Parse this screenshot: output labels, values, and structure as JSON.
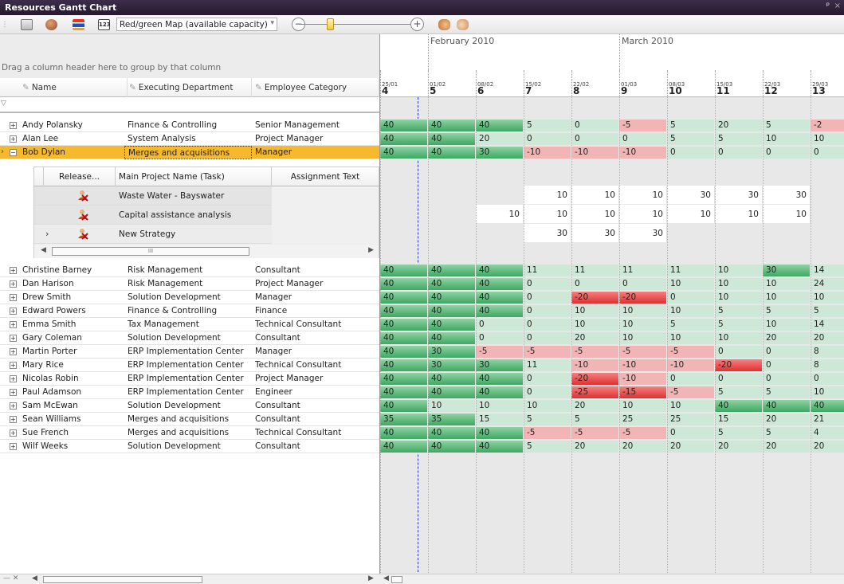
{
  "window": {
    "title": "Resources Gantt Chart"
  },
  "toolbar": {
    "map_select": "Red/green Map (available capacity)"
  },
  "group_panel": {
    "text": "Drag a column header here to group by that column"
  },
  "columns": {
    "name": "Name",
    "department": "Executing Department",
    "category": "Employee Category"
  },
  "detail_columns": {
    "release": "Release...",
    "project": "Main Project Name (Task)",
    "assignment": "Assignment Text"
  },
  "timeline": {
    "months": [
      "February 2010",
      "March 2010"
    ],
    "weeks": [
      {
        "date": "25/01",
        "num": "4"
      },
      {
        "date": "01/02",
        "num": "5"
      },
      {
        "date": "08/02",
        "num": "6"
      },
      {
        "date": "15/02",
        "num": "7"
      },
      {
        "date": "22/02",
        "num": "8"
      },
      {
        "date": "01/03",
        "num": "9"
      },
      {
        "date": "08/03",
        "num": "10"
      },
      {
        "date": "15/03",
        "num": "11"
      },
      {
        "date": "22/03",
        "num": "12"
      },
      {
        "date": "29/03",
        "num": "13"
      }
    ]
  },
  "resources": [
    {
      "name": "Andy Polansky",
      "department": "Finance & Controlling",
      "category": "Senior Management",
      "capacity": [
        "40",
        "40",
        "40",
        "5",
        "0",
        "-5",
        "5",
        "20",
        "5",
        "-2"
      ]
    },
    {
      "name": "Alan Lee",
      "department": "System Analysis",
      "category": "Project Manager",
      "capacity": [
        "40",
        "40",
        "20",
        "0",
        "0",
        "0",
        "5",
        "5",
        "10",
        "10"
      ]
    },
    {
      "name": "Bob Dylan",
      "department": "Merges and acquisitions",
      "category": "Manager",
      "capacity": [
        "40",
        "40",
        "30",
        "-10",
        "-10",
        "-10",
        "0",
        "0",
        "0",
        "0"
      ]
    },
    {
      "name": "Christine Barney",
      "department": "Risk Management",
      "category": "Consultant",
      "capacity": [
        "40",
        "40",
        "40",
        "11",
        "11",
        "11",
        "11",
        "10",
        "30",
        "14"
      ]
    },
    {
      "name": "Dan Harison",
      "department": "Risk Management",
      "category": "Project Manager",
      "capacity": [
        "40",
        "40",
        "40",
        "0",
        "0",
        "0",
        "10",
        "10",
        "10",
        "24"
      ]
    },
    {
      "name": "Drew Smith",
      "department": "Solution Development",
      "category": "Manager",
      "capacity": [
        "40",
        "40",
        "40",
        "0",
        "-20",
        "-20",
        "0",
        "10",
        "10",
        "10"
      ]
    },
    {
      "name": "Edward Powers",
      "department": "Finance & Controlling",
      "category": "Finance",
      "capacity": [
        "40",
        "40",
        "40",
        "0",
        "10",
        "10",
        "10",
        "5",
        "5",
        "5"
      ]
    },
    {
      "name": "Emma Smith",
      "department": "Tax Management",
      "category": "Technical Consultant",
      "capacity": [
        "40",
        "40",
        "0",
        "0",
        "10",
        "10",
        "5",
        "5",
        "10",
        "14"
      ]
    },
    {
      "name": "Gary Coleman",
      "department": "Solution Development",
      "category": "Consultant",
      "capacity": [
        "40",
        "40",
        "0",
        "0",
        "20",
        "10",
        "10",
        "10",
        "20",
        "20"
      ]
    },
    {
      "name": "Martin Porter",
      "department": "ERP Implementation Center",
      "category": "Manager",
      "capacity": [
        "40",
        "30",
        "-5",
        "-5",
        "-5",
        "-5",
        "-5",
        "0",
        "0",
        "8"
      ]
    },
    {
      "name": "Mary Rice",
      "department": "ERP Implementation Center",
      "category": "Technical Consultant",
      "capacity": [
        "40",
        "30",
        "30",
        "11",
        "-10",
        "-10",
        "-10",
        "-20",
        "0",
        "8"
      ]
    },
    {
      "name": "Nicolas Robin",
      "department": "ERP Implementation Center",
      "category": "Project Manager",
      "capacity": [
        "40",
        "40",
        "40",
        "0",
        "-20",
        "-10",
        "0",
        "0",
        "0",
        "0"
      ]
    },
    {
      "name": "Paul Adamson",
      "department": "ERP Implementation Center",
      "category": "Engineer",
      "capacity": [
        "40",
        "40",
        "40",
        "0",
        "-25",
        "-15",
        "-5",
        "5",
        "5",
        "10"
      ]
    },
    {
      "name": "Sam McEwan",
      "department": "Solution Development",
      "category": "Consultant",
      "capacity": [
        "40",
        "10",
        "10",
        "10",
        "20",
        "10",
        "10",
        "40",
        "40",
        "40"
      ]
    },
    {
      "name": "Sean Williams",
      "department": "Merges and acquisitions",
      "category": "Consultant",
      "capacity": [
        "35",
        "35",
        "15",
        "5",
        "5",
        "25",
        "25",
        "15",
        "20",
        "21"
      ]
    },
    {
      "name": "Sue French",
      "department": "Merges and acquisitions",
      "category": "Technical Consultant",
      "capacity": [
        "40",
        "40",
        "40",
        "-5",
        "-5",
        "-5",
        "0",
        "5",
        "5",
        "4"
      ]
    },
    {
      "name": "Wilf Weeks",
      "department": "Solution Development",
      "category": "Consultant",
      "capacity": [
        "40",
        "40",
        "40",
        "5",
        "20",
        "20",
        "20",
        "20",
        "20",
        "20"
      ]
    }
  ],
  "tasks": [
    {
      "project": "Waste Water - Bayswater",
      "hours": [
        "",
        "",
        "",
        "10",
        "10",
        "10",
        "30",
        "30",
        "30",
        ""
      ]
    },
    {
      "project": "Capital assistance analysis",
      "hours": [
        "",
        "",
        "10",
        "10",
        "10",
        "10",
        "10",
        "10",
        "10",
        ""
      ]
    },
    {
      "project": "New Strategy",
      "hours": [
        "",
        "",
        "",
        "30",
        "30",
        "30",
        "",
        "",
        "",
        ""
      ]
    }
  ]
}
